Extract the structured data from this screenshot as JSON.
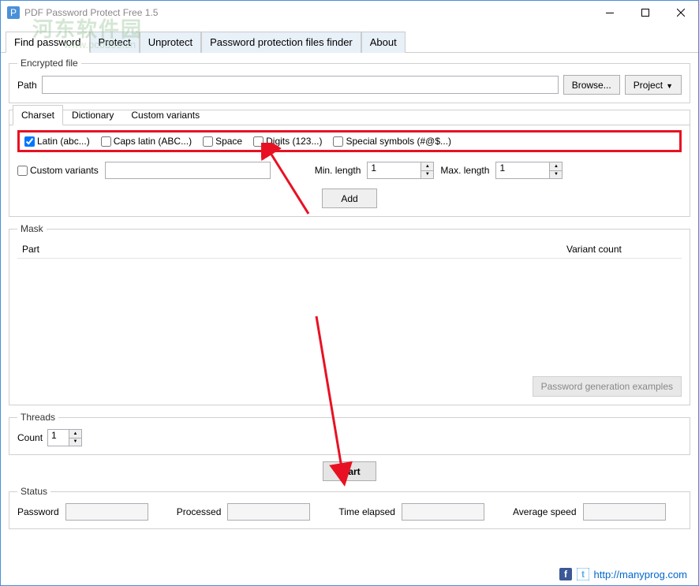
{
  "window": {
    "title": "PDF Password Protect Free 1.5"
  },
  "watermark": {
    "main": "河东软件园",
    "sub": "www.pc0359.cn"
  },
  "tabs": {
    "find_password": "Find password",
    "protect": "Protect",
    "unprotect": "Unprotect",
    "protection_finder": "Password protection files finder",
    "about": "About"
  },
  "encrypted": {
    "legend": "Encrypted file",
    "path_label": "Path",
    "path_value": "",
    "browse": "Browse...",
    "project": "Project"
  },
  "subtabs": {
    "charset": "Charset",
    "dictionary": "Dictionary",
    "custom": "Custom variants"
  },
  "charset": {
    "latin": "Latin (abc...)",
    "caps": "Caps latin (ABC...)",
    "space": "Space",
    "digits": "Digits (123...)",
    "special": "Special symbols (#@$...)",
    "custom_variants": "Custom variants",
    "custom_value": "",
    "min_length": "Min. length",
    "min_value": "1",
    "max_length": "Max. length",
    "max_value": "1",
    "add": "Add"
  },
  "mask": {
    "legend": "Mask",
    "col_part": "Part",
    "col_variant": "Variant count",
    "examples": "Password generation examples"
  },
  "threads": {
    "legend": "Threads",
    "count_label": "Count",
    "count_value": "1"
  },
  "start": {
    "label": "Start"
  },
  "status": {
    "legend": "Status",
    "password": "Password",
    "processed": "Processed",
    "time_elapsed": "Time elapsed",
    "avg_speed": "Average speed"
  },
  "footer": {
    "url": "http://manyprog.com"
  }
}
